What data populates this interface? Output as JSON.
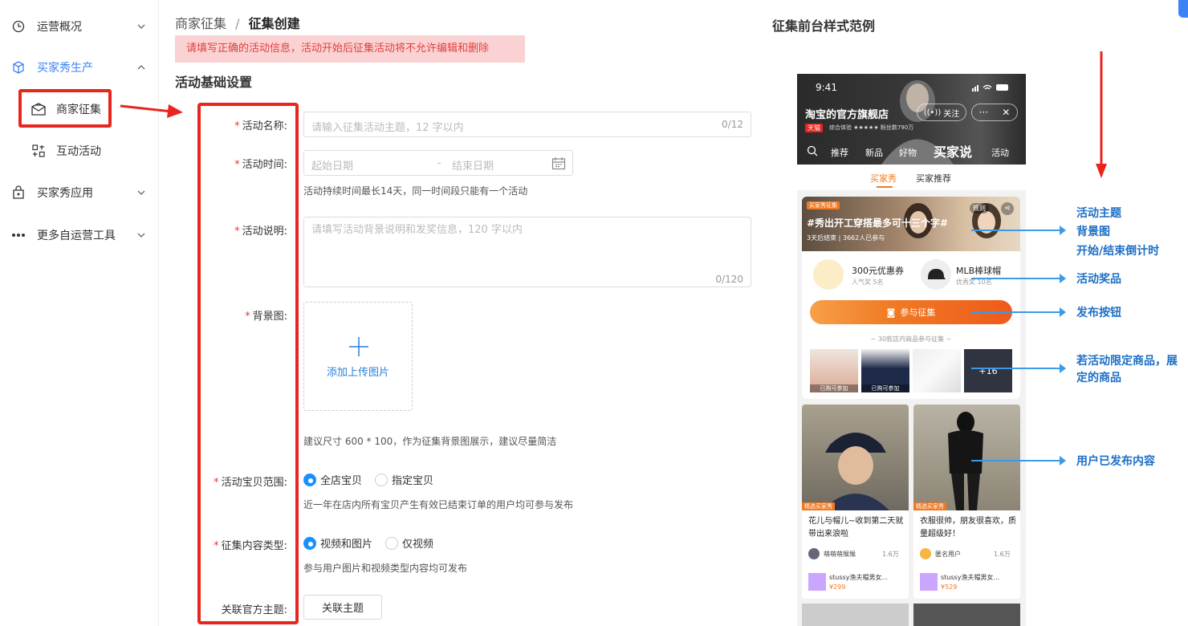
{
  "sidebar": {
    "items": [
      {
        "label": "运营概况",
        "icon": "clock-icon"
      },
      {
        "label": "买家秀生产",
        "icon": "cube-icon"
      },
      {
        "label": "商家征集",
        "icon": "mail-icon"
      },
      {
        "label": "互动活动",
        "icon": "grid-icon"
      },
      {
        "label": "买家秀应用",
        "icon": "bag-icon"
      },
      {
        "label": "更多自运营工具",
        "icon": "more-icon"
      }
    ]
  },
  "breadcrumb": {
    "parent": "商家征集",
    "sep": "/",
    "current": "征集创建"
  },
  "alert": "请填写正确的活动信息，活动开始后征集活动将不允许编辑和删除",
  "section_title": "活动基础设置",
  "form": {
    "name": {
      "label": "活动名称:",
      "placeholder": "请输入征集活动主题，12 字以内",
      "counter": "0/12"
    },
    "time": {
      "label": "活动时间:",
      "start_placeholder": "起始日期",
      "sep": "-",
      "end_placeholder": "结束日期",
      "hint": "活动持续时间最长14天，同一时间段只能有一个活动"
    },
    "desc": {
      "label": "活动说明:",
      "placeholder": "请填写活动背景说明和发奖信息，120 字以内",
      "counter": "0/120"
    },
    "bg": {
      "label": "背景图:",
      "upload_label": "添加上传图片",
      "hint": "建议尺寸 600 * 100，作为征集背景图展示，建议尽量简洁"
    },
    "scope": {
      "label": "活动宝贝范围:",
      "options": [
        "全店宝贝",
        "指定宝贝"
      ],
      "selected": "全店宝贝",
      "hint": "近一年在店内所有宝贝产生有效已结束订单的用户均可参与发布"
    },
    "content_type": {
      "label": "征集内容类型:",
      "options": [
        "视频和图片",
        "仅视频"
      ],
      "selected": "视频和图片",
      "hint": "参与用户图片和视频类型内容均可发布"
    },
    "theme": {
      "label": "关联官方主题:",
      "button": "关联主题"
    },
    "required_mark": "*"
  },
  "preview": {
    "title": "征集前台样式范例",
    "status_time": "9:41",
    "shop_name": "淘宝的官方旗舰店",
    "follow": "关注",
    "tmall_badge": "天猫",
    "shop_meta": "综合体验 ★★★★★  粉丝数790万",
    "nav_tabs": [
      "推荐",
      "新品",
      "好物",
      "买家说",
      "活动"
    ],
    "sub_tabs": [
      "买家秀",
      "买家推荐"
    ],
    "banner_tag": "买家秀征集",
    "banner_rule": "规则",
    "banner_title": "#秀出开工穿搭最多可十三个字#",
    "banner_meta": "3天后结束 | 3662人已参与",
    "prizes": [
      {
        "name": "300元优惠券",
        "sub": "人气奖 5名"
      },
      {
        "name": "MLB棒球帽",
        "sub": "优秀奖 10名"
      }
    ],
    "join_button": "参与征集",
    "products_caption": "~ 30款店内商品参与征集 ~",
    "product_tags": [
      "已购可参加",
      "已购可参加"
    ],
    "more_count": "+16",
    "posts": [
      {
        "tag": "精选买家秀",
        "text": "花儿与帽儿~收到第二天就带出来浪啦",
        "user": "萌萌萌猴猴",
        "likes": "1.6万",
        "product": "stussy渔夫帽男女...",
        "price": "¥299"
      },
      {
        "tag": "精选买家秀",
        "text": "衣服很帅，朋友很喜欢，质量超级好！",
        "user": "匿名用户",
        "likes": "1.6万",
        "product": "stussy渔夫帽男女...",
        "price": "¥529"
      }
    ]
  },
  "annotations": [
    "活动主题",
    "背景图",
    "开始/结束倒计时",
    "活动奖品",
    "发布按钮",
    "若活动限定商品，展\n定的商品",
    "用户已发布内容"
  ],
  "colors": {
    "accent": "#3b82f6",
    "alert_bg": "#fbd2d3",
    "alert_text": "#e0403c",
    "required": "#e53935",
    "annotation_red": "#e8261e",
    "annotation_blue": "#1d6fc6",
    "join_orange": "#f07a23"
  }
}
